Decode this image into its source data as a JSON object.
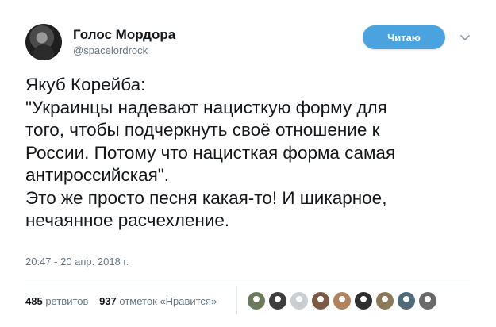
{
  "author": {
    "name": "Голос Мордора",
    "handle": "@spacelordrock"
  },
  "follow_button": {
    "label": "Читаю"
  },
  "tweet": {
    "lines": [
      "Якуб Корейба:",
      "\"Украинцы надевают нацисткую форму для",
      "того, чтобы подчеркнуть своё отношение к",
      "России. Потому что нацисткая форма самая",
      "антироссийская\".",
      "Это же просто песня какая-то! И шикарное,",
      "нечаянное расчехление."
    ],
    "timestamp": "20:47 - 20 апр. 2018 г."
  },
  "stats": {
    "retweets_count": "485",
    "retweets_label": "ретвитов",
    "likes_count": "937",
    "likes_label": "отметок «Нравится»"
  },
  "likers_avatars": [
    {
      "color": "#6b7a5c"
    },
    {
      "color": "#3d3d3d"
    },
    {
      "color": "#c9ced3"
    },
    {
      "color": "#7a5a44"
    },
    {
      "color": "#b0845e"
    },
    {
      "color": "#2e2e2e"
    },
    {
      "color": "#8a7a5a"
    },
    {
      "color": "#4f6b7a"
    },
    {
      "color": "#6a6a6a"
    }
  ],
  "colors": {
    "accent": "#4aa3df",
    "text": "#14171a",
    "muted": "#657786"
  }
}
